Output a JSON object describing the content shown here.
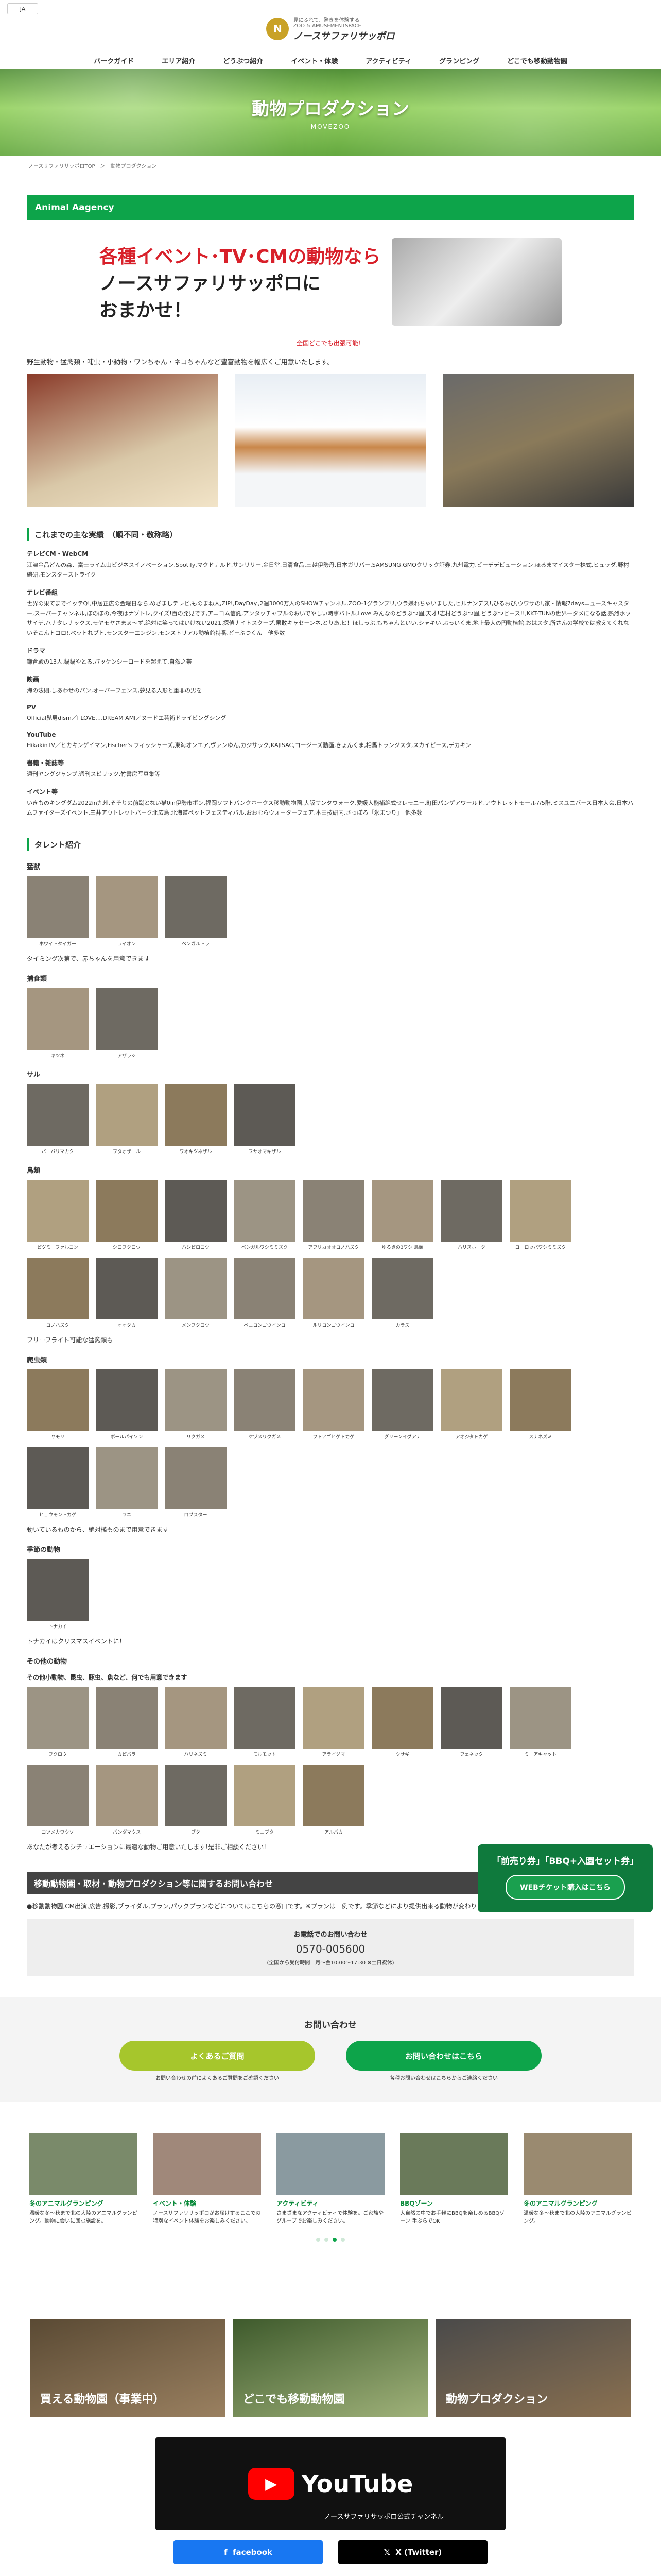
{
  "lang": {
    "label": "JA"
  },
  "header": {
    "tagline": "見にふれて、驚きを体験する",
    "tagline_sub": "ZOO & AMUSEMENTSPACE",
    "logo_text": "ノースサファリサッポロ"
  },
  "nav": [
    "パークガイド",
    "エリア紹介",
    "どうぶつ紹介",
    "イベント・体験",
    "アクティビティ",
    "グランピング",
    "どこでも移動動物園"
  ],
  "hero": {
    "title": "動物プロダクション",
    "subtitle": "MOVEZOO"
  },
  "breadcrumb": "ノースサファリサッポロTOP　＞　動物プロダクション",
  "section_title": "Animal Aagency",
  "banner": {
    "line1": "各種イベント･TV･CMの動物なら",
    "line2": "ノースサファリサッポロに",
    "line3": "おまかせ！"
  },
  "red_note": "全国どこでも出張可能！",
  "intro": "野生動物・猛禽類・哺虫・小動物・ワンちゃん・ネコちゃんなど豊富動物を幅広くご用意いたします。",
  "achievements": {
    "title": "これまでの主な実績　（順不同・敬称略）",
    "items": [
      {
        "h": "テレビCM・WebCM",
        "t": "江津金品どんの森、富士ライム山ビジネスイノベーション,Spotify,マクドナルド,サンリリー,金日堂,日清食品,三越伊勢丹,日本ガリバー,SAMSUNG,GMOクリック証券,九州電力,ビーチデビューション,ほるまマイスター株式,ヒュッダ,野村總研,モンスターストライク"
      },
      {
        "h": "テレビ番組",
        "t": "世界の果てまでイッテQ!,中居正広の金曜日なら,めざましテレビ,ものまね人,ZIP!,DayDay.,2週3000万人のSHOWチャンネル,ZOO-1グランプリ,ウラ嫌れちゃいました,ヒルナンデス!,ひるおび,ウワサの!,家・情報7daysニュースキャスター,スーパーチャンネル,ぼのぼの,今夜はナゾトレ,クイズ!百の発見です,アニコム信託,アンタッチャブルのおいでやしい時事バトル,Love みんなのどうぶつ園,天才!志村どうぶつ園,どうぶつピース!!,KKT-TUNの世界一タメになる話,熟烈ホッサイテ,ハナタレナックス,モヤモヤさまぁ～ず,絶対に笑ってはいけない2021,探偵ナイトスクープ,果敢キャセーンネ,とりあ,ヒ！ほしっぷ,もちゃんといい,シャキい,ぶっいくま,地上最大の円動植館,おはスタ,所さんの学校では教えてくれないそこんトコロ!,ベットれブト,モンスターエンジン,モンストリアル動植館特番,どーぶつくん　他多数"
      },
      {
        "h": "ドラマ",
        "t": "鎌倉殿の13人,鍋鍋やとる,パッケンシーロードを超えて,自然之帯"
      },
      {
        "h": "映画",
        "t": "海の法則,しあわせのパン,オーバーフェンス,夢見る人形と重罪の男を"
      },
      {
        "h": "PV",
        "t": "Official髭男dism／I LOVE…,DREAM AMI／ヌードエ芸術ドライビングシング"
      },
      {
        "h": "YouTube",
        "t": "HikakinTV／ヒカキンゲイマン,Fischer's フィッシャーズ,東海オンエア,ヴァンゆん,カジサック,KAJISAC,コージーズ動画,きょんくま,相馬トランジスタ,スカイピース,デカキン"
      },
      {
        "h": "書籍・雑誌等",
        "t": "週刊ヤングジャンプ,週刊スピリッツ,竹書房写真集等"
      },
      {
        "h": "イベント等",
        "t": "いきものキングダム2022in九州,そそりの前蹴とない猫0in伊勢市ポン,福岡ソフトバンクホークス移動動物園,大阪サンタウォーク,愛媛人能補絶式セレモニー,町田パンゲアワールド,アウトレットモール7/5階,ミスユニバース日本大会,日本ハムファイターズイベント,三井アウトレットパーク北広島,北海道ペットフェスティバル,おおむらウォーターフェア,本田技研内,さっぽろ「氷まつり」　他多数"
      }
    ]
  },
  "talents": {
    "title": "タレント紹介",
    "groups": [
      {
        "name": "猛獣",
        "animals": [
          "ホワイトタイガー",
          "ライオン",
          "ベンガルトラ"
        ],
        "note": "タイミング次第で、赤ちゃんを用意できます"
      },
      {
        "name": "捕食類",
        "animals": [
          "キツネ",
          "アザラシ"
        ]
      },
      {
        "name": "サル",
        "animals": [
          "バーバリマカク",
          "ブタオザール",
          "ワオキツネザル",
          "フサオマキザル"
        ]
      },
      {
        "name": "鳥類",
        "animals": [
          "ピグミーファルコン",
          "シロフクロウ",
          "ハシビロコウ",
          "ベンガルワシミミズク",
          "アフリカオオコノハズク",
          "ゆるきの3ワシ 鳥類",
          "ハリスホーク",
          "ヨーロッパワシミミズク",
          "コノハズク",
          "オオタカ",
          "メンフクロウ",
          "ベニコンゴウインコ",
          "ルリコンゴウインコ",
          "カラス"
        ],
        "note": "フリーフライト可能な猛禽類も"
      },
      {
        "name": "爬虫類",
        "animals": [
          "ヤモリ",
          "ボールパイソン",
          "リクガメ",
          "ケヅメリクガメ",
          "フトアゴヒゲトカゲ",
          "グリーンイグアナ",
          "アオジタトカゲ",
          "スナネズミ",
          "ヒョウモントカゲ",
          "ワニ",
          "ロブスター"
        ],
        "note": "動いているものから、絶対檻ものまで用意できます"
      },
      {
        "name": "季節の動物",
        "animals": [
          "トナカイ"
        ],
        "note": "トナカイはクリスマスイベントに！"
      },
      {
        "name": "その他の動物",
        "animals": [
          "フクロウ",
          "カピバラ",
          "ハリネズミ",
          "モルモット",
          "アライグマ",
          "ウサギ",
          "フェネック",
          "ミーアキャット",
          "コツメカワウソ",
          "パンダマウス",
          "ブタ",
          "ミニブタ",
          "アルパカ"
        ],
        "sub": "その他小動物、昆虫、豚虫、魚など、何でも用意できます"
      }
    ],
    "closing": "あなたが考えるシチュエーションに最適な動物ご用意いたします!是非ご相談ください!"
  },
  "inquiry_section": {
    "title": "移動動物園・取材・動物プロダクション等に関するお問い合わせ",
    "body": "●移動動物園,CM出演,広告,撮影,ブライダル,プラン,パックプランなどについてはこちらの窓口です。※プランは一例です。季節などにより提供出来る動物が変わりますので、詳しくはお問い合わせ下さい。",
    "phone_label": "お電話でのお問い合わせ",
    "phone": "0570-005600",
    "hours": "(全国から受付時間　月〜金10:00〜17:30 ※土日祝休)"
  },
  "contact": {
    "title": "お問い合わせ",
    "faq_button": "よくあるご質問",
    "form_button": "お問い合わせはこちら",
    "faq_sub": "お問い合わせの前によくあるご質問をご確認ください",
    "form_sub": "各種お問い合わせはこちらからご連絡ください"
  },
  "float_ad": {
    "text": "「前売り券」「BBQ+入園セット券」",
    "button": "WEBチケット購入はこちら"
  },
  "carousel": [
    {
      "title": "冬のアニマルグランピング",
      "desc": "温暖な冬〜秋まで北の大陸のアニマルグランピング。動物に会いに囲む施設を。"
    },
    {
      "title": "イベント・体験",
      "desc": "ノースサファリサッポロがお届けするここでの特別なイベント体験をお楽しみください。"
    },
    {
      "title": "アクティビティ",
      "desc": "さまざまなアクティビティで体験を。ご家族やグループでお楽しみください。"
    },
    {
      "title": "BBQゾーン",
      "desc": "大自然の中でお手軽にBBQを楽しめるBBQゾーン!手ぶらでOK"
    },
    {
      "title": "冬のアニマルグランピング",
      "desc": "温暖な冬〜秋まで北の大陸のアニマルグランピング。"
    }
  ],
  "tiles": [
    "買える動物園（事業中）",
    "どこでも移動動物園",
    "動物プロダクション"
  ],
  "youtube": {
    "label": "YouTube",
    "channel": "ノースサファリサッポロ公式チャンネル"
  },
  "social": {
    "facebook": "facebook",
    "x": "X (Twitter)"
  },
  "colors": {
    "green": "#0da44a",
    "red": "#d8202a",
    "lime": "#a6c62c"
  }
}
